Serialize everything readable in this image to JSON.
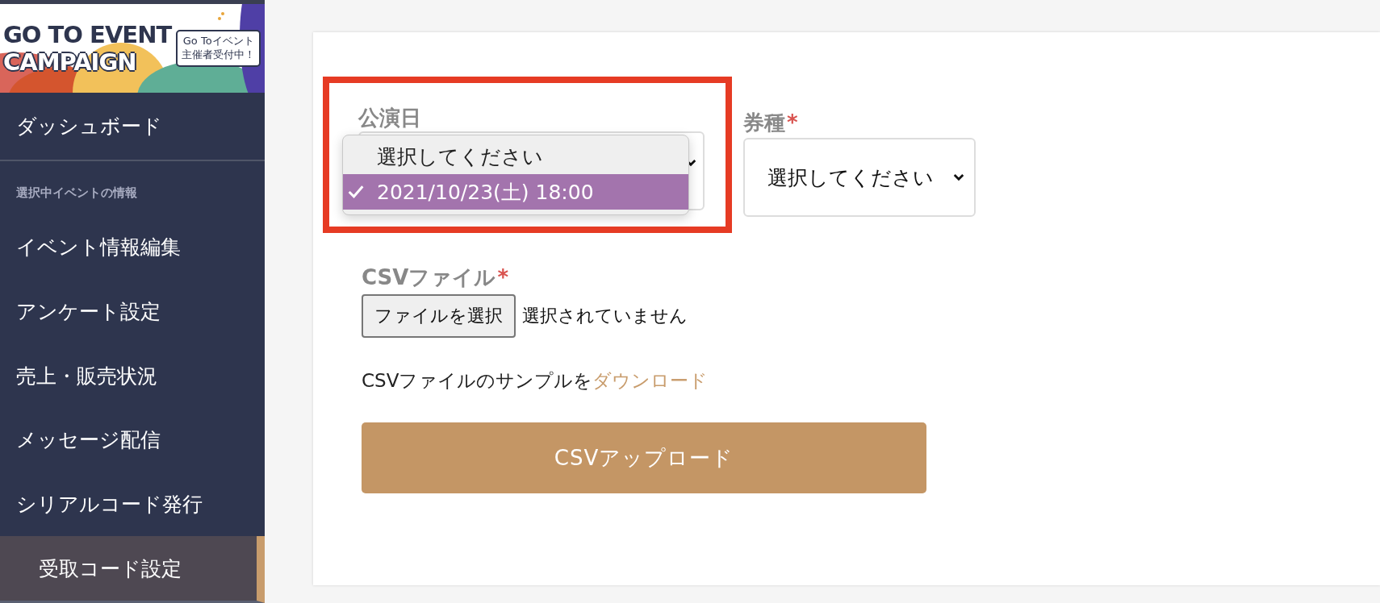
{
  "logo": {
    "line_1": "GO TO EVENT",
    "line_2": "CAMPAIGN",
    "badge_line_1": "Go Toイベント",
    "badge_line_2": "主催者受付中！"
  },
  "sidebar": {
    "items": [
      {
        "label": "ダッシュボード",
        "kind": "item",
        "selected": false
      },
      {
        "label": "選択中イベントの情報",
        "kind": "section"
      },
      {
        "label": "イベント情報編集",
        "kind": "item",
        "selected": false
      },
      {
        "label": "アンケート設定",
        "kind": "item",
        "selected": false
      },
      {
        "label": "売上・販売状況",
        "kind": "item",
        "selected": false
      },
      {
        "label": "メッセージ配信",
        "kind": "item",
        "selected": false
      },
      {
        "label": "シリアルコード発行",
        "kind": "item",
        "selected": false
      },
      {
        "label": "受取コード設定",
        "kind": "item",
        "selected": true
      }
    ]
  },
  "form": {
    "date_field": {
      "label": "公演日",
      "highlighted": true,
      "options": [
        {
          "label": "選択してください",
          "selected": false
        },
        {
          "label": "2021/10/23(土) 18:00",
          "selected": true
        }
      ]
    },
    "ticket_field": {
      "label": "券種",
      "required_mark": "*",
      "value": "選択してください"
    },
    "csv_field": {
      "label": "CSVファイル",
      "required_mark": "*",
      "button": "ファイルを選択",
      "status": "選択されていません"
    },
    "sample_text": "CSVファイルのサンプルを",
    "sample_link": "ダウンロード",
    "upload_button": "CSVアップロード"
  }
}
